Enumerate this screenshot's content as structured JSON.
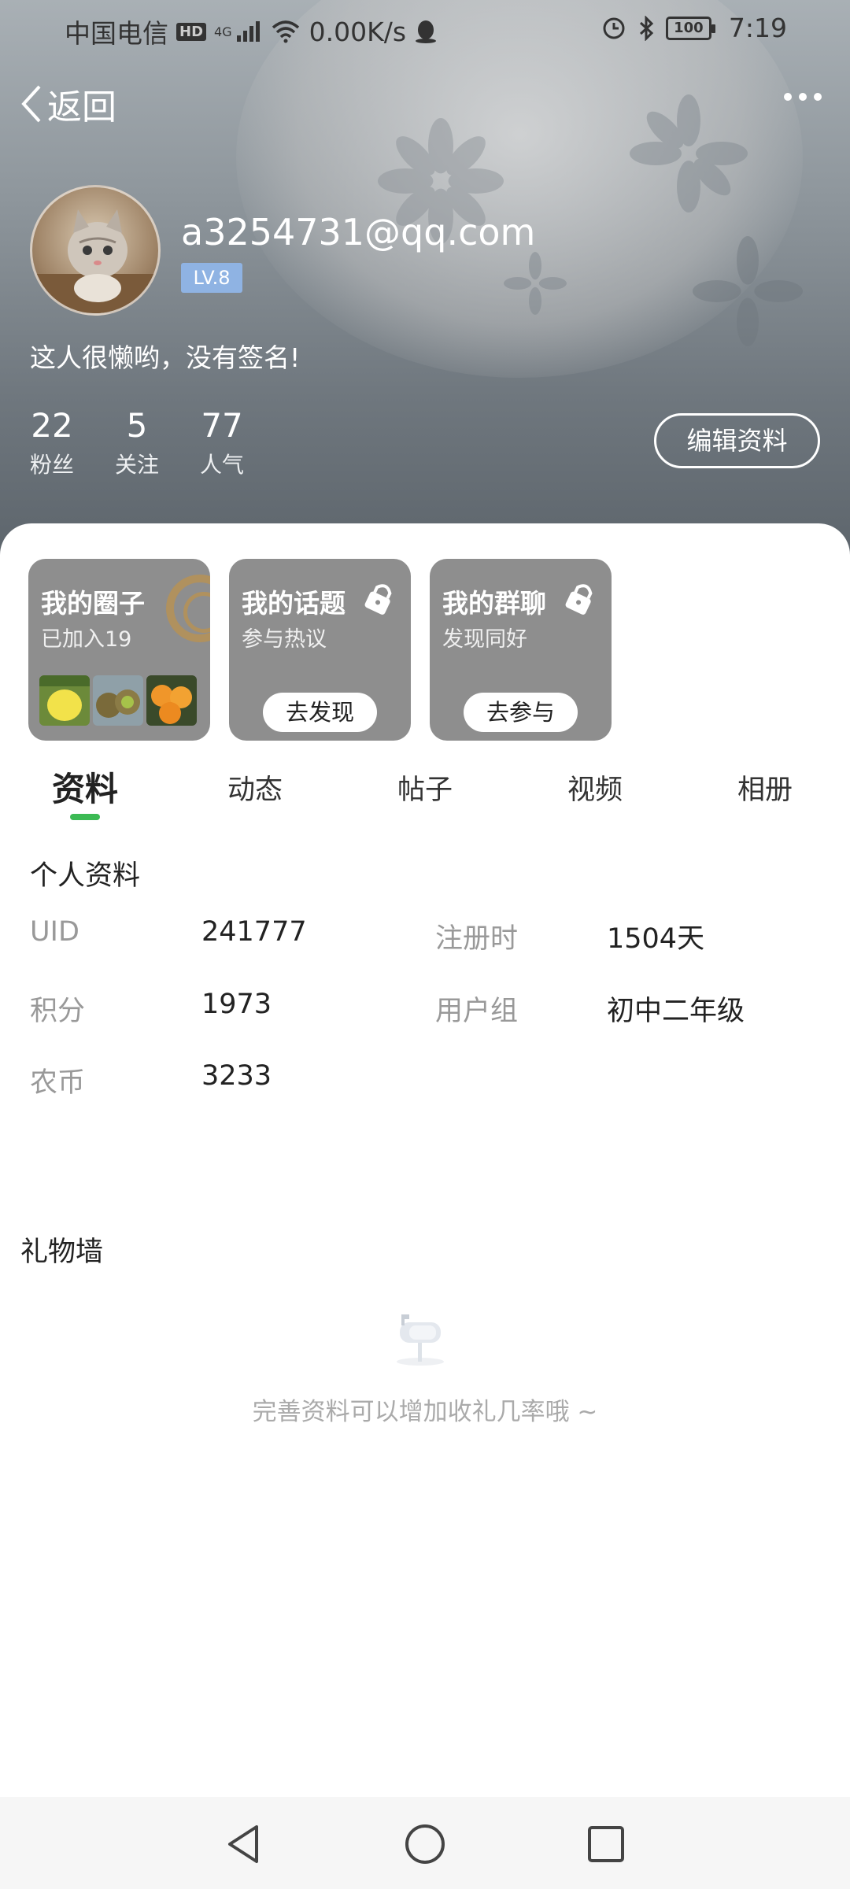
{
  "status_bar": {
    "carrier": "中国电信",
    "hd_badge": "HD",
    "network": "4G",
    "speed": "0.00K/s",
    "battery": "100",
    "time": "7:19"
  },
  "nav": {
    "back_label": "返回"
  },
  "profile": {
    "username": "a3254731@qq.com",
    "level": "LV.8",
    "signature": "这人很懒哟，没有签名!",
    "stats": [
      {
        "value": "22",
        "label": "粉丝"
      },
      {
        "value": "5",
        "label": "关注"
      },
      {
        "value": "77",
        "label": "人气"
      }
    ],
    "edit_button": "编辑资料"
  },
  "cards": [
    {
      "title": "我的圈子",
      "subtitle": "已加入19",
      "button": ""
    },
    {
      "title": "我的话题",
      "subtitle": "参与热议",
      "button": "去发现"
    },
    {
      "title": "我的群聊",
      "subtitle": "发现同好",
      "button": "去参与"
    }
  ],
  "tabs": [
    "资料",
    "动态",
    "帖子",
    "视频",
    "相册"
  ],
  "personal_info": {
    "title": "个人资料",
    "fields": [
      {
        "label": "UID",
        "value": "241777"
      },
      {
        "label": "注册时",
        "value": "1504天"
      },
      {
        "label": "积分",
        "value": "1973"
      },
      {
        "label": "用户组",
        "value": "初中二年级"
      },
      {
        "label": "农币",
        "value": "3233"
      }
    ]
  },
  "gift_wall": {
    "title": "礼物墙",
    "empty_text": "完善资料可以增加收礼几率哦 ~"
  },
  "colors": {
    "accent": "#3cba54",
    "level_badge": "#8fb3e3",
    "card_bg": "#8e8e8e"
  },
  "icons": [
    "back-arrow-icon",
    "more-icon",
    "lock-icon",
    "mailbox-icon",
    "nav-back-icon",
    "nav-home-icon",
    "nav-recents-icon"
  ]
}
